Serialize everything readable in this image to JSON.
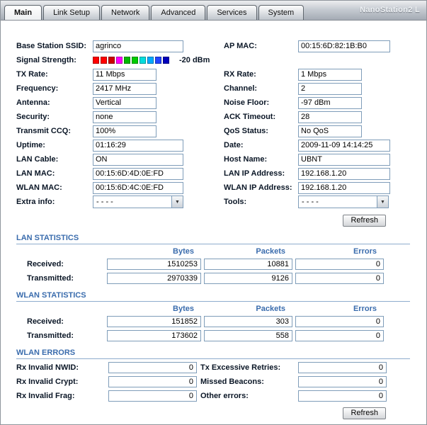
{
  "brand": "NanoStation2 L",
  "tabs": [
    {
      "label": "Main",
      "active": true
    },
    {
      "label": "Link Setup",
      "active": false
    },
    {
      "label": "Network",
      "active": false
    },
    {
      "label": "Advanced",
      "active": false
    },
    {
      "label": "Services",
      "active": false
    },
    {
      "label": "System",
      "active": false
    }
  ],
  "status": {
    "base_station_ssid": {
      "label": "Base Station SSID:",
      "value": "agrinco"
    },
    "ap_mac": {
      "label": "AP MAC:",
      "value": "00:15:6D:82:1B:B0"
    },
    "signal_strength": {
      "label": "Signal Strength:",
      "value": "-20 dBm",
      "segments": [
        "#ff0000",
        "#ff0000",
        "#cc0000",
        "#ff00ff",
        "#00bb00",
        "#00cc00",
        "#00dddd",
        "#00aaff",
        "#2244ff",
        "#0000bb"
      ]
    },
    "tx_rate": {
      "label": "TX Rate:",
      "value": "11 Mbps"
    },
    "rx_rate": {
      "label": "RX Rate:",
      "value": "1 Mbps"
    },
    "frequency": {
      "label": "Frequency:",
      "value": "2417 MHz"
    },
    "channel": {
      "label": "Channel:",
      "value": "2"
    },
    "antenna": {
      "label": "Antenna:",
      "value": "Vertical"
    },
    "noise_floor": {
      "label": "Noise Floor:",
      "value": "-97 dBm"
    },
    "security": {
      "label": "Security:",
      "value": "none"
    },
    "ack_timeout": {
      "label": "ACK Timeout:",
      "value": "28"
    },
    "transmit_ccq": {
      "label": "Transmit CCQ:",
      "value": "100%"
    },
    "qos_status": {
      "label": "QoS Status:",
      "value": "No QoS"
    },
    "uptime": {
      "label": "Uptime:",
      "value": "01:16:29"
    },
    "date": {
      "label": "Date:",
      "value": "2009-11-09 14:14:25"
    },
    "lan_cable": {
      "label": "LAN Cable:",
      "value": "ON"
    },
    "host_name": {
      "label": "Host Name:",
      "value": "UBNT"
    },
    "lan_mac": {
      "label": "LAN MAC:",
      "value": "00:15:6D:4D:0E:FD"
    },
    "lan_ip": {
      "label": "LAN IP Address:",
      "value": "192.168.1.20"
    },
    "wlan_mac": {
      "label": "WLAN MAC:",
      "value": "00:15:6D:4C:0E:FD"
    },
    "wlan_ip": {
      "label": "WLAN IP Address:",
      "value": "192.168.1.20"
    },
    "extra_info": {
      "label": "Extra info:",
      "value": "- - - -"
    },
    "tools": {
      "label": "Tools:",
      "value": "- - - -"
    }
  },
  "buttons": {
    "refresh": "Refresh"
  },
  "lan_statistics": {
    "title": "LAN STATISTICS",
    "columns": [
      "Bytes",
      "Packets",
      "Errors"
    ],
    "rows": [
      {
        "label": "Received:",
        "bytes": "1510253",
        "packets": "10881",
        "errors": "0"
      },
      {
        "label": "Transmitted:",
        "bytes": "2970339",
        "packets": "9126",
        "errors": "0"
      }
    ]
  },
  "wlan_statistics": {
    "title": "WLAN STATISTICS",
    "columns": [
      "Bytes",
      "Packets",
      "Errors"
    ],
    "rows": [
      {
        "label": "Received:",
        "bytes": "151852",
        "packets": "303",
        "errors": "0"
      },
      {
        "label": "Transmitted:",
        "bytes": "173602",
        "packets": "558",
        "errors": "0"
      }
    ]
  },
  "wlan_errors": {
    "title": "WLAN ERRORS",
    "rows": [
      {
        "left_label": "Rx Invalid NWID:",
        "left_value": "0",
        "right_label": "Tx Excessive Retries:",
        "right_value": "0"
      },
      {
        "left_label": "Rx Invalid Crypt:",
        "left_value": "0",
        "right_label": "Missed Beacons:",
        "right_value": "0"
      },
      {
        "left_label": "Rx Invalid Frag:",
        "left_value": "0",
        "right_label": "Other errors:",
        "right_value": "0"
      }
    ]
  }
}
